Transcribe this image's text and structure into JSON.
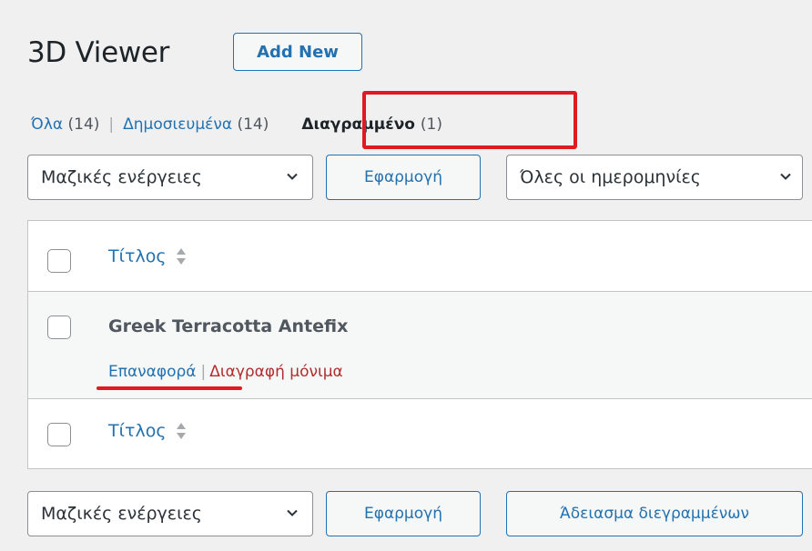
{
  "page": {
    "title": "3D Viewer",
    "add_new_label": "Add New"
  },
  "views": [
    {
      "label": "Όλα",
      "count": "(14)"
    },
    {
      "label": "Δημοσιευμένα",
      "count": "(14)"
    },
    {
      "label": "Διαγραμμένο",
      "count": "(1)",
      "current": true
    }
  ],
  "views_separator": "|",
  "top_nav": {
    "bulk_actions_selected": "Μαζικές ενέργειες",
    "apply_label": "Εφαρμογή",
    "dates_filter_selected": "Όλες οι ημερομηνίες"
  },
  "table": {
    "column_title": "Τίτλος",
    "rows": [
      {
        "title": "Greek Terracotta Antefix",
        "actions": {
          "restore": "Επαναφορά",
          "separator": "|",
          "delete_permanently": "Διαγραφή μόνιμα"
        }
      }
    ]
  },
  "bottom_nav": {
    "bulk_actions_selected": "Μαζικές ενέργειες",
    "apply_label": "Εφαρμογή",
    "empty_trash_label": "Άδειασμα διεγραμμένων"
  },
  "colors": {
    "background": "#f0f0f1",
    "link": "#2271b1",
    "delete": "#b32d2e",
    "annotation_red": "#e01a22"
  },
  "icons": {
    "dropdown": "chevron-down-icon",
    "sort": "sort-arrows-icon"
  }
}
